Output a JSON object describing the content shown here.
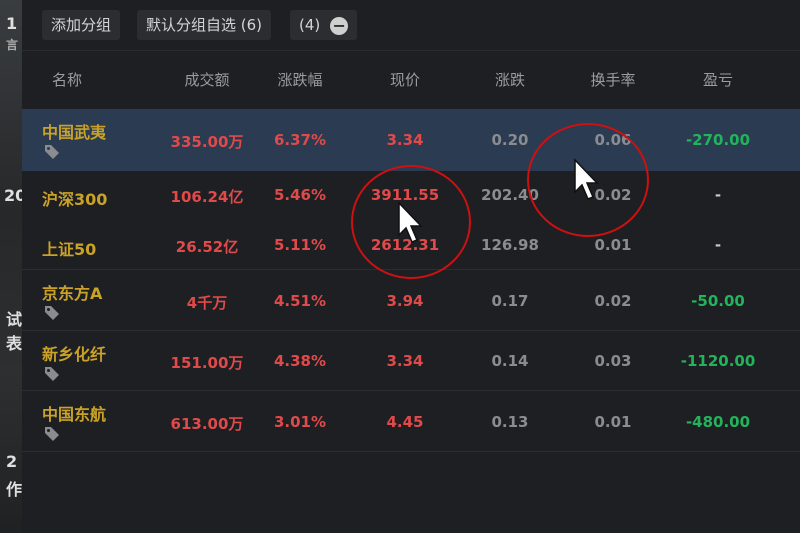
{
  "toolbar": {
    "add_group": "添加分组",
    "default_group": "默认分组自选 (6)",
    "count": "(4)"
  },
  "columns": [
    "名称",
    "成交额",
    "涨跌幅",
    "现价",
    "涨跌",
    "换手率",
    "盈亏"
  ],
  "rows": [
    {
      "name": "中国武夷",
      "volume": "335.00万",
      "change_pct": "6.37%",
      "price": "3.34",
      "change": "0.20",
      "turnover": "0.06",
      "pnl": "-270.00",
      "tag": true,
      "selected": true
    },
    {
      "name": "沪深300",
      "volume": "106.24亿",
      "change_pct": "5.46%",
      "price": "3911.55",
      "change": "202.40",
      "turnover": "0.02",
      "pnl": "-",
      "tag": false
    },
    {
      "name": "上证50",
      "volume": "26.52亿",
      "change_pct": "5.11%",
      "price": "2612.31",
      "change": "126.98",
      "turnover": "0.01",
      "pnl": "-",
      "tag": false
    },
    {
      "name": "京东方A",
      "volume": "4千万",
      "change_pct": "4.51%",
      "price": "3.94",
      "change": "0.17",
      "turnover": "0.02",
      "pnl": "-50.00",
      "tag": true
    },
    {
      "name": "新乡化纤",
      "volume": "151.00万",
      "change_pct": "4.38%",
      "price": "3.34",
      "change": "0.14",
      "turnover": "0.03",
      "pnl": "-1120.00",
      "tag": true
    },
    {
      "name": "中国东航",
      "volume": "613.00万",
      "change_pct": "3.01%",
      "price": "4.45",
      "change": "0.13",
      "turnover": "0.01",
      "pnl": "-480.00",
      "tag": true
    }
  ],
  "left_strip_fragments": [
    "1",
    "言",
    "20",
    "试",
    "表",
    "2",
    "作"
  ],
  "colors": {
    "name": "#c9a227",
    "up": "#e04a4a",
    "pnl": "#22b45b",
    "selected_row": "#2a3b52",
    "annotation": "#cc1111"
  },
  "icons": [
    "minus-circle-icon",
    "tag-icon",
    "cursor-arrow-icon"
  ]
}
